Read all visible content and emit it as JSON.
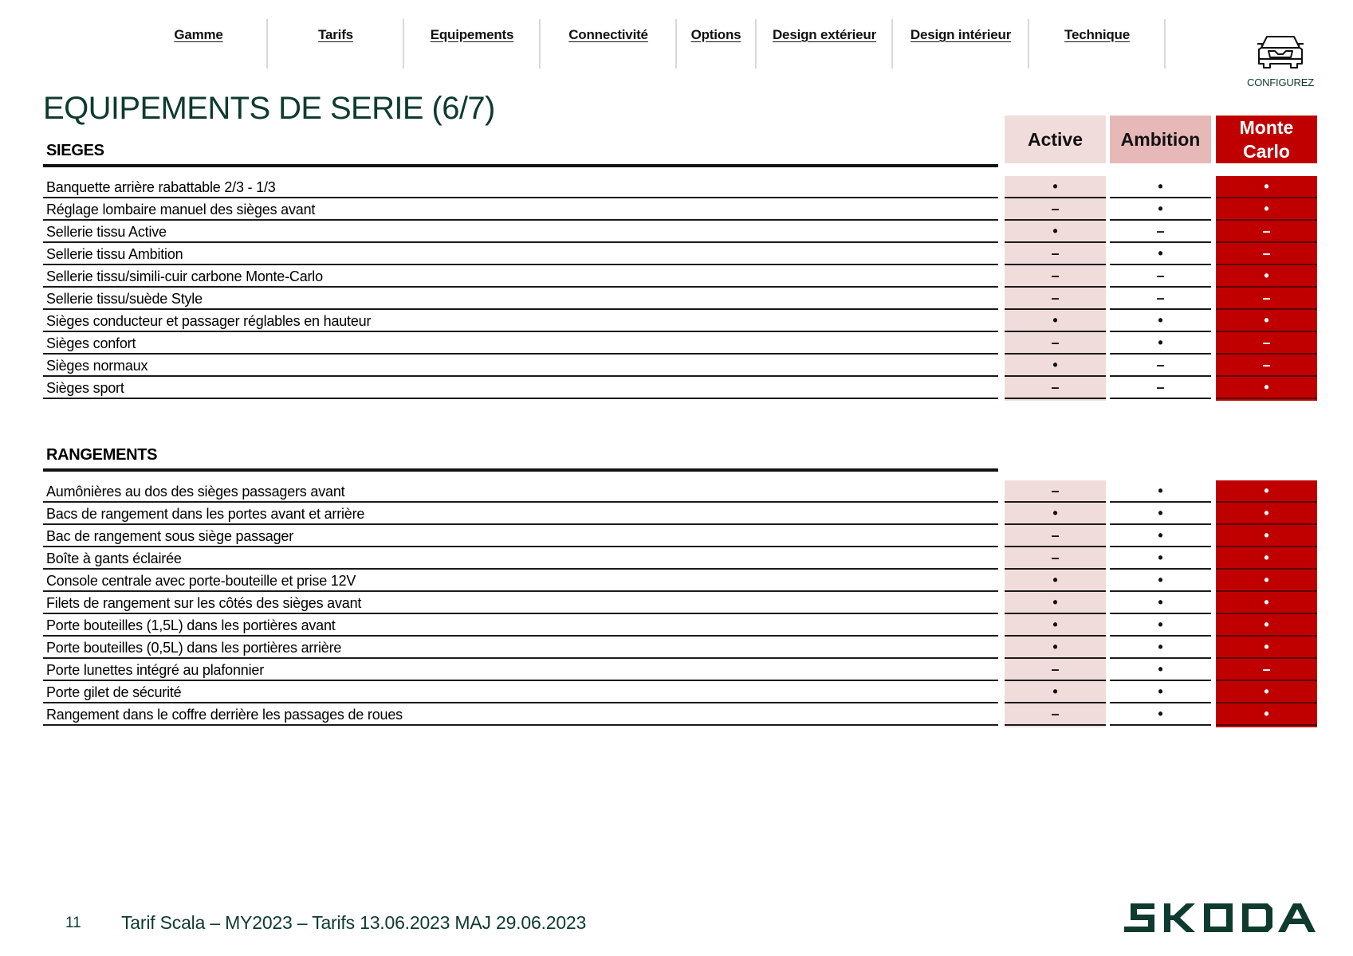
{
  "nav": {
    "items": [
      {
        "label": "Gamme"
      },
      {
        "label": "Tarifs"
      },
      {
        "label": "Equipements"
      },
      {
        "label": "Connectivité"
      },
      {
        "label": "Options"
      },
      {
        "label": "Design extérieur"
      },
      {
        "label": "Design intérieur"
      },
      {
        "label": "Technique"
      }
    ],
    "configure_label": "CONFIGUREZ",
    "configure_icon": "car-front-icon"
  },
  "page": {
    "title": "EQUIPEMENTS DE SERIE (6/7)"
  },
  "trims": {
    "active": "Active",
    "ambition": "Ambition",
    "monte_carlo": "Monte Carlo"
  },
  "legend": {
    "standard": "•",
    "not_available": "–"
  },
  "colors": {
    "brand_green": "#0e3a2f",
    "active_bg": "#f1dcdc",
    "ambition_bg": "#e6b8b8",
    "monte_carlo_bg": "#c00000"
  },
  "sections": [
    {
      "title": "SIEGES",
      "rows": [
        {
          "label": "Banquette arrière rabattable 2/3 - 1/3",
          "active": "•",
          "ambition": "•",
          "monte_carlo": "•"
        },
        {
          "label": "Réglage lombaire manuel des sièges avant",
          "active": "–",
          "ambition": "•",
          "monte_carlo": "•"
        },
        {
          "label": "Sellerie tissu Active",
          "active": "•",
          "ambition": "–",
          "monte_carlo": "–"
        },
        {
          "label": "Sellerie tissu Ambition",
          "active": "–",
          "ambition": "•",
          "monte_carlo": "–"
        },
        {
          "label": "Sellerie tissu/simili-cuir carbone Monte-Carlo",
          "active": "–",
          "ambition": "–",
          "monte_carlo": "•"
        },
        {
          "label": "Sellerie tissu/suède Style",
          "active": "–",
          "ambition": "–",
          "monte_carlo": "–"
        },
        {
          "label": "Sièges conducteur et passager réglables en hauteur",
          "active": "•",
          "ambition": "•",
          "monte_carlo": "•"
        },
        {
          "label": "Sièges confort",
          "active": "–",
          "ambition": "•",
          "monte_carlo": "–"
        },
        {
          "label": "Sièges normaux",
          "active": "•",
          "ambition": "–",
          "monte_carlo": "–"
        },
        {
          "label": "Sièges sport",
          "active": "–",
          "ambition": "–",
          "monte_carlo": "•"
        }
      ]
    },
    {
      "title": "RANGEMENTS",
      "rows": [
        {
          "label": "Aumônières au dos des sièges passagers avant",
          "active": "–",
          "ambition": "•",
          "monte_carlo": "•"
        },
        {
          "label": "Bacs de rangement dans les portes avant et arrière",
          "active": "•",
          "ambition": "•",
          "monte_carlo": "•"
        },
        {
          "label": "Bac de rangement sous siège passager",
          "active": "–",
          "ambition": "•",
          "monte_carlo": "•"
        },
        {
          "label": "Boîte à gants éclairée",
          "active": "–",
          "ambition": "•",
          "monte_carlo": "•"
        },
        {
          "label": "Console centrale avec porte-bouteille et prise 12V",
          "active": "•",
          "ambition": "•",
          "monte_carlo": "•"
        },
        {
          "label": "Filets de rangement sur les côtés des sièges avant",
          "active": "•",
          "ambition": "•",
          "monte_carlo": "•"
        },
        {
          "label": "Porte bouteilles (1,5L) dans les portières avant",
          "active": "•",
          "ambition": "•",
          "monte_carlo": "•"
        },
        {
          "label": "Porte bouteilles (0,5L) dans les portières arrière",
          "active": "•",
          "ambition": "•",
          "monte_carlo": "•"
        },
        {
          "label": "Porte lunettes intégré au plafonnier",
          "active": "–",
          "ambition": "•",
          "monte_carlo": "–"
        },
        {
          "label": "Porte gilet de sécurité",
          "active": "•",
          "ambition": "•",
          "monte_carlo": "•"
        },
        {
          "label": "Rangement dans le coffre derrière les passages de roues",
          "active": "–",
          "ambition": "•",
          "monte_carlo": "•"
        }
      ]
    }
  ],
  "footer": {
    "page_number": "11",
    "text": "Tarif Scala – MY2023 – Tarifs 13.06.2023 MAJ 29.06.2023",
    "logo_text": "SKODA"
  }
}
